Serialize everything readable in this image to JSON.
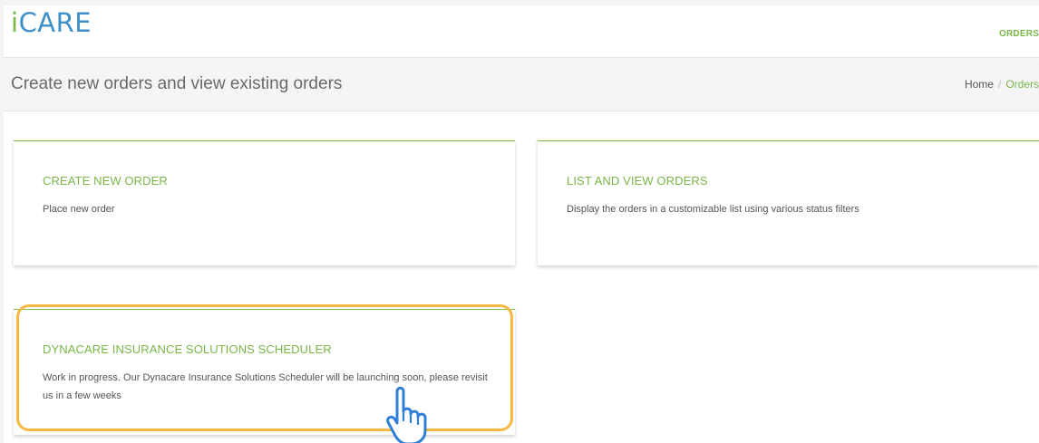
{
  "header": {
    "logo_i": "i",
    "logo_rest": "CARE",
    "nav_orders": "ORDERS"
  },
  "titlebar": {
    "title": "Create new orders and view existing orders",
    "breadcrumb": {
      "home": "Home",
      "separator": "/",
      "current": "Orders"
    }
  },
  "cards": [
    {
      "title": "CREATE NEW ORDER",
      "text": "Place new order"
    },
    {
      "title": "LIST AND VIEW ORDERS",
      "text": "Display the orders in a customizable list using various status filters"
    },
    {
      "title": "DYNACARE INSURANCE SOLUTIONS SCHEDULER",
      "text": "Work in progress. Our Dynacare Insurance Solutions Scheduler will be launching soon, please revisit us in a few weeks"
    }
  ],
  "colors": {
    "accent_green": "#7ab648",
    "logo_blue": "#3d8fc7",
    "highlight_orange": "#f5b942",
    "cursor_blue": "#2f7fd6"
  },
  "icons": {
    "cursor": "hand-pointer-icon"
  }
}
